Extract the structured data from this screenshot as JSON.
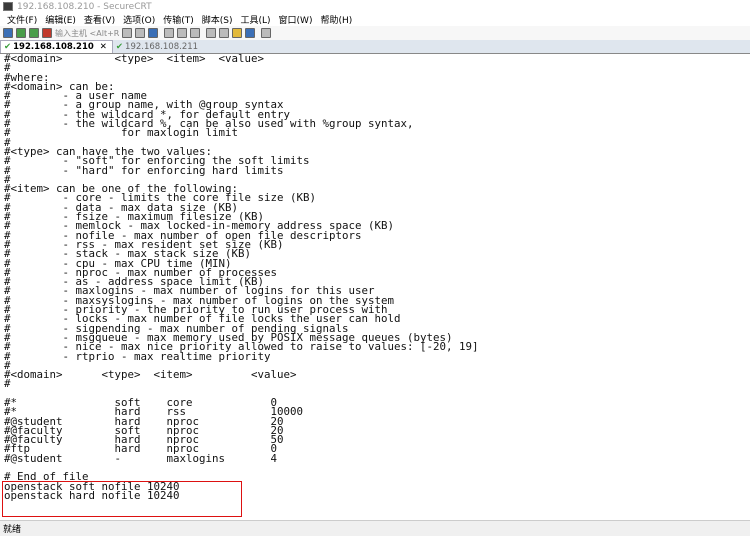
{
  "window": {
    "title": "192.168.108.210 - SecureCRT"
  },
  "menu": [
    "文件(F)",
    "编辑(E)",
    "查看(V)",
    "选项(O)",
    "传输(T)",
    "脚本(S)",
    "工具(L)",
    "窗口(W)",
    "帮助(H)"
  ],
  "toolbar": {
    "quick_connect_placeholder": "输入主机 <Alt+R"
  },
  "tabs": [
    {
      "label": "192.168.108.210",
      "active": true
    },
    {
      "label": "192.168.108.211",
      "active": false
    }
  ],
  "terminal": {
    "lines": [
      "#<domain>        <type>  <item>  <value>",
      "#",
      "#where:",
      "#<domain> can be:",
      "#        - a user name",
      "#        - a group name, with @group syntax",
      "#        - the wildcard *, for default entry",
      "#        - the wildcard %, can be also used with %group syntax,",
      "#                 for maxlogin limit",
      "#",
      "#<type> can have the two values:",
      "#        - \"soft\" for enforcing the soft limits",
      "#        - \"hard\" for enforcing hard limits",
      "#",
      "#<item> can be one of the following:",
      "#        - core - limits the core file size (KB)",
      "#        - data - max data size (KB)",
      "#        - fsize - maximum filesize (KB)",
      "#        - memlock - max locked-in-memory address space (KB)",
      "#        - nofile - max number of open file descriptors",
      "#        - rss - max resident set size (KB)",
      "#        - stack - max stack size (KB)",
      "#        - cpu - max CPU time (MIN)",
      "#        - nproc - max number of processes",
      "#        - as - address space limit (KB)",
      "#        - maxlogins - max number of logins for this user",
      "#        - maxsyslogins - max number of logins on the system",
      "#        - priority - the priority to run user process with",
      "#        - locks - max number of file locks the user can hold",
      "#        - sigpending - max number of pending signals",
      "#        - msgqueue - max memory used by POSIX message queues (bytes)",
      "#        - nice - max nice priority allowed to raise to values: [-20, 19]",
      "#        - rtprio - max realtime priority",
      "#",
      "#<domain>      <type>  <item>         <value>",
      "#",
      "",
      "#*               soft    core            0",
      "#*               hard    rss             10000",
      "#@student        hard    nproc           20",
      "#@faculty        soft    nproc           20",
      "#@faculty        hard    nproc           50",
      "#ftp             hard    nproc           0",
      "#@student        -       maxlogins       4",
      "",
      "# End of file",
      "openstack soft nofile 10240",
      "openstack hard nofile 10240"
    ]
  },
  "status": {
    "text": "就绪"
  },
  "colors": {
    "highlight_border": "#dd1111",
    "tab_check": "#3a9d3a"
  }
}
